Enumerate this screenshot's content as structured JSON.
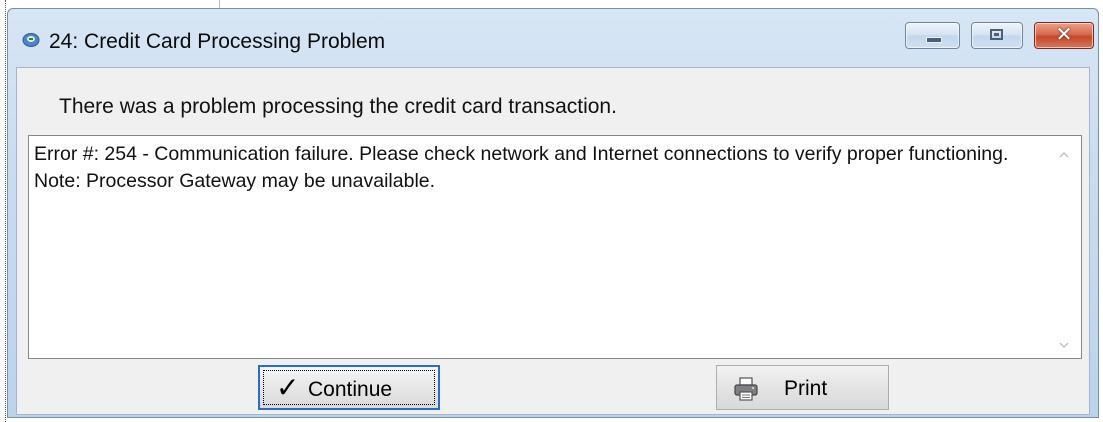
{
  "window": {
    "title": "24: Credit Card Processing Problem",
    "close_glyph": "✕"
  },
  "dialog": {
    "message": "There was a problem processing the credit card transaction.",
    "error_text": "Error #: 254 - Communication failure.  Please check network and Internet connections to verify proper functioning. Note: Processor Gateway may be unavailable."
  },
  "buttons": {
    "continue_label": "Continue",
    "continue_icon": "✓",
    "print_label": "Print"
  },
  "icons": {
    "app": "app-icon",
    "minimize": "minimize-icon",
    "maximize": "maximize-icon",
    "close": "close-icon",
    "scroll_up": "chevron-up-icon",
    "scroll_down": "chevron-down-icon",
    "continue": "checkmark-icon",
    "print": "printer-icon"
  },
  "colors": {
    "titlebar": "#c9dcf0",
    "close_button": "#c94f33",
    "focus_border": "#2d6dbf",
    "client_bg": "#f0f0f0"
  }
}
